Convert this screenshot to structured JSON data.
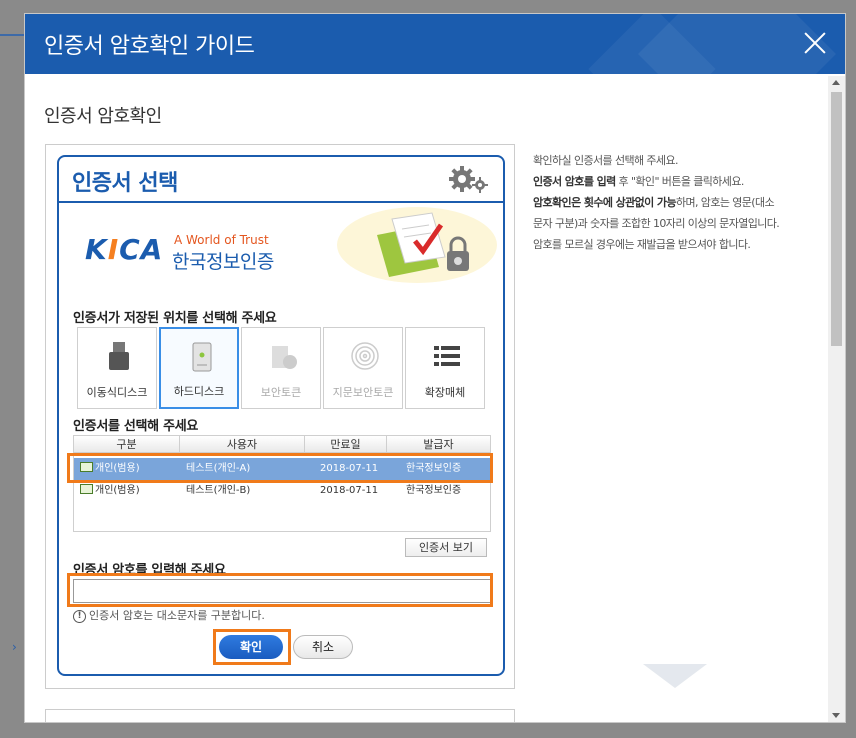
{
  "modal": {
    "title": "인증서 암호확인 가이드",
    "close_label": "close",
    "section_title": "인증서 암호확인"
  },
  "cert_dialog": {
    "title": "인증서 선택",
    "brand": {
      "logo": "KICA",
      "tagline": "A World of Trust",
      "name": "한국정보인증"
    },
    "location_label": "인증서가 저장된 위치를 선택해 주세요",
    "media": [
      {
        "label": "이동식디스크",
        "state": "enabled",
        "icon": "usb-drive-icon"
      },
      {
        "label": "하드디스크",
        "state": "selected",
        "icon": "hard-disk-icon"
      },
      {
        "label": "보안토큰",
        "state": "disabled",
        "icon": "security-token-icon"
      },
      {
        "label": "지문보안토큰",
        "state": "disabled",
        "icon": "fingerprint-icon"
      },
      {
        "label": "확장매체",
        "state": "enabled",
        "icon": "list-icon"
      }
    ],
    "select_label": "인증서를 선택해 주세요",
    "table": {
      "headers": [
        "구분",
        "사용자",
        "만료일",
        "발급자"
      ],
      "rows": [
        {
          "type": "개인(범용)",
          "user": "테스트(개인-A)",
          "expires": "2018-07-11",
          "issuer": "한국정보인증"
        },
        {
          "type": "개인(범용)",
          "user": "테스트(개인-B)",
          "expires": "2018-07-11",
          "issuer": "한국정보인증"
        }
      ],
      "selected_row": 0
    },
    "view_button": "인증서 보기",
    "password_label": "인증서 암호를 입력해 주세요",
    "password_value": "",
    "note": "인증서 암호는 대소문자를 구분합니다.",
    "ok_button": "확인",
    "cancel_button": "취소"
  },
  "guide": {
    "line1": "확인하실 인증서를 선택해 주세요.",
    "line2_bold": "인증서 암호를 입력",
    "line2_rest": " 후 \"확인\" 버튼을 클릭하세요.",
    "line3_bold": "암호확인은 횟수에 상관없이 가능",
    "line3_rest": "하며, 암호는 영문(대소문자 구분)과 숫자를 조합한 10자리 이상의 문자열입니다. 암호를 모르실 경우에는 재발급을 받으셔야 합니다."
  },
  "colors": {
    "brand_blue": "#1b5cae",
    "highlight_orange": "#f07a1a",
    "selected_row": "#7aa5da"
  }
}
